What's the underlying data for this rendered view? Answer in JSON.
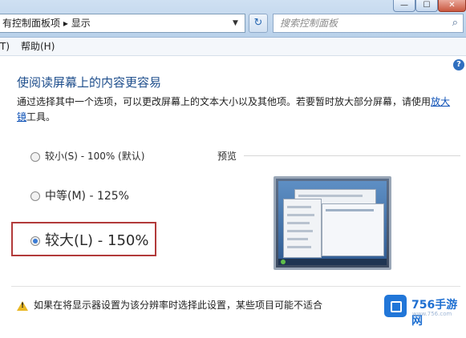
{
  "window": {
    "min_glyph": "—",
    "max_glyph": "☐",
    "close_glyph": "✕"
  },
  "address": {
    "path_root": "有控制面板项",
    "separator": "▸",
    "path_current": "显示",
    "dropdown_glyph": "▼",
    "refresh_glyph": "↻"
  },
  "search": {
    "placeholder": "搜索控制面板",
    "icon": "search-icon",
    "icon_glyph": "⌕"
  },
  "menu": {
    "tools": "T)",
    "help": "帮助(H)"
  },
  "help_glyph": "?",
  "main": {
    "heading": "使阅读屏幕上的内容更容易",
    "description": "通过选择其中一个选项，可以更改屏幕上的文本大小以及其他项。若要暂时放大部分屏幕，请使用",
    "magnifier_link": "放大镜",
    "description_tail": "工具。",
    "options": [
      {
        "label": "较小(S) - 100% (默认)",
        "selected": false
      },
      {
        "label": "中等(M) - 125%",
        "selected": false
      },
      {
        "label": "较大(L) - 150%",
        "selected": true
      }
    ],
    "preview_label": "预览",
    "warning": "如果在将显示器设置为该分辨率时选择此设置，某些项目可能不适合"
  },
  "watermark": {
    "brand": "756手游网",
    "sub": "www.756.com"
  },
  "colors": {
    "accent": "#1e4e8c",
    "highlight_box": "#b23a3a",
    "link": "#0b4fb5"
  }
}
